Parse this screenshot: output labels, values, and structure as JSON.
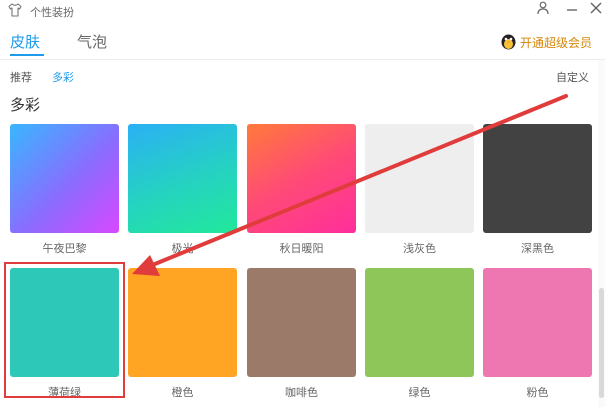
{
  "window": {
    "title": "个性装扮"
  },
  "tabs": [
    {
      "label": "皮肤",
      "active": true
    },
    {
      "label": "气泡",
      "active": false
    }
  ],
  "vip": {
    "label": "开通超级会员"
  },
  "subtabs": [
    {
      "label": "推荐",
      "active": false
    },
    {
      "label": "多彩",
      "active": true
    }
  ],
  "custom_label": "自定义",
  "section": {
    "title": "多彩"
  },
  "swatches": [
    {
      "label": "午夜巴黎",
      "color": "#8a6cff"
    },
    {
      "label": "极光",
      "color": "#25d3c0"
    },
    {
      "label": "秋日暖阳",
      "color": "#ff4a77"
    },
    {
      "label": "浅灰色",
      "color": "#eeeeee"
    },
    {
      "label": "深黑色",
      "color": "#424242"
    },
    {
      "label": "薄荷绿",
      "color": "#2dc8b8",
      "selected": true
    },
    {
      "label": "橙色",
      "color": "#ffa423"
    },
    {
      "label": "咖啡色",
      "color": "#9b7a6a"
    },
    {
      "label": "绿色",
      "color": "#8ec65a"
    },
    {
      "label": "粉色",
      "color": "#ee77b2"
    }
  ],
  "colors": {
    "accent": "#1e9bea",
    "vip": "#d6860a",
    "annotation": "#e03c3c"
  }
}
